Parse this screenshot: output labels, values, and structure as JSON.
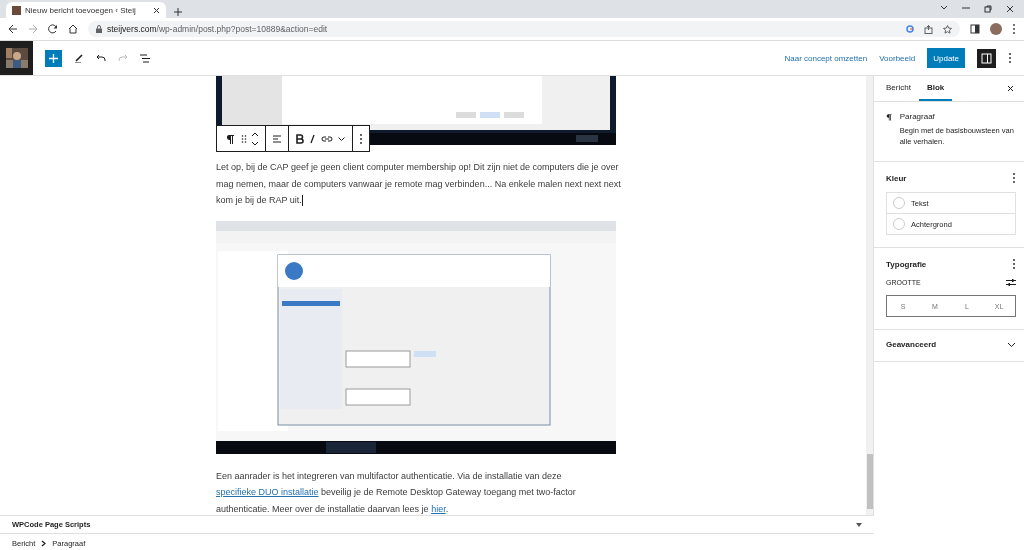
{
  "browser": {
    "tab_title": "Nieuw bericht toevoegen ‹ Steij",
    "url_host": "steijvers.com",
    "url_path": "/wp-admin/post.php?post=10889&action=edit"
  },
  "toolbar": {
    "actions": [
      "Naar concept omzetten",
      "Voorbeeld"
    ],
    "primary": "Update"
  },
  "content": {
    "blocks": [
      {
        "kind": "picture",
        "cropped": true
      },
      {
        "kind": "paragraph",
        "selected": true,
        "segments": [
          {
            "kind": "text",
            "text": "Let op, bij de CAP geef je geen client computer membership op! Dit zijn niet de computers die je over mag nemen, maar de computers vanwaar je remote mag verbinden... Na enkele malen next next next kom je bij de RAP uit."
          }
        ]
      },
      {
        "kind": "picture",
        "cropped": false
      },
      {
        "kind": "paragraph",
        "selected": false,
        "segments": [
          {
            "kind": "text",
            "text": "Een aanrader is het integreren van multifactor authenticatie. Via de installatie van deze "
          },
          {
            "kind": "link",
            "text": "specifieke DUO installatie"
          },
          {
            "kind": "text",
            "text": " beveilig je de Remote Desktop Gateway toegang met two-factor authenticatie. Meer over de installatie daarvan lees je "
          },
          {
            "kind": "link",
            "text": "hier"
          },
          {
            "kind": "text",
            "text": "."
          }
        ]
      }
    ]
  },
  "sidebar": {
    "tabs": [
      {
        "label": "Bericht",
        "selected": false
      },
      {
        "label": "Blok",
        "selected": true
      }
    ],
    "block": {
      "title": "Paragraaf",
      "description": "Begin met de basisbouwsteen van alle verhalen."
    },
    "panels": [
      {
        "kind": "color",
        "title": "Kleur",
        "options": [
          "Tekst",
          "Achtergrond"
        ]
      },
      {
        "kind": "typography",
        "title": "Typografie",
        "size_label": "GROOTTE",
        "sizes": [
          "S",
          "M",
          "L",
          "XL"
        ]
      },
      {
        "kind": "collapsed",
        "title": "Geavanceerd"
      }
    ]
  },
  "footer": {
    "meta_box": "WPCode Page Scripts",
    "breadcrumb": [
      "Bericht",
      "Paragraaf"
    ]
  }
}
